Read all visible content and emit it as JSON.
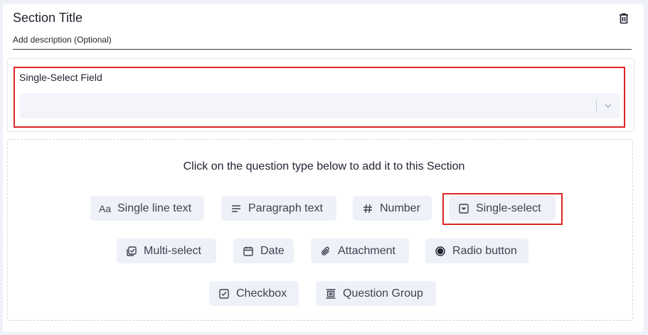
{
  "section": {
    "title": "Section Title",
    "description_placeholder": "Add description (Optional)"
  },
  "field": {
    "label": "Single-Select Field",
    "value": ""
  },
  "palette": {
    "hint": "Click on the question type below to add it to this Section",
    "types": [
      {
        "label": "Single line text",
        "icon": "text-aa-icon"
      },
      {
        "label": "Paragraph text",
        "icon": "paragraph-icon"
      },
      {
        "label": "Number",
        "icon": "hash-icon"
      },
      {
        "label": "Single-select",
        "icon": "dropdown-box-icon"
      },
      {
        "label": "Multi-select",
        "icon": "multi-check-icon"
      },
      {
        "label": "Date",
        "icon": "calendar-icon"
      },
      {
        "label": "Attachment",
        "icon": "paperclip-icon"
      },
      {
        "label": "Radio button",
        "icon": "radio-icon"
      },
      {
        "label": "Checkbox",
        "icon": "checkbox-icon"
      },
      {
        "label": "Question Group",
        "icon": "group-icon"
      }
    ]
  },
  "colors": {
    "highlight": "#e02424",
    "chip_bg": "#eef1f8"
  }
}
